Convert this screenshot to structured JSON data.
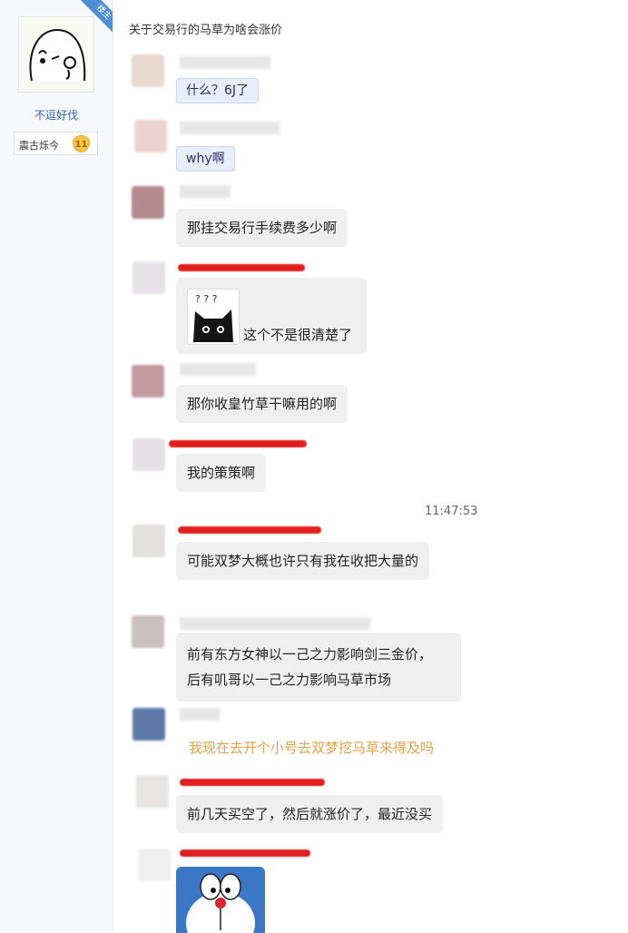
{
  "sidebar": {
    "badge": "楼主",
    "username": "不逗好伐",
    "rank_name": "震古烁今",
    "rank_level": "11"
  },
  "post": {
    "title": "关于交易行的马草为啥会涨价"
  },
  "timestamp": "11:47:53",
  "messages": [
    {
      "text": "什么？6J了"
    },
    {
      "text": "why啊"
    },
    {
      "text": "那挂交易行手续费多少啊"
    },
    {
      "text": "这个不是很清楚了"
    },
    {
      "text": "那你收皇竹草干嘛用的啊"
    },
    {
      "text": "我的策策啊"
    },
    {
      "text": "可能双梦大概也许只有我在收把大量的"
    },
    {
      "line1": "前有东方女神以一己之力影响剑三金价，",
      "line2": "后有叽哥以一己之力影响马草市场"
    },
    {
      "text": "我现在去开个小号去双梦挖马草来得及吗"
    },
    {
      "text": "前几天买空了，然后就涨价了，最近没买"
    }
  ],
  "icons": {
    "avatar": "cartoon-face-avatar",
    "level": "shield-level-icon",
    "sticker_cat": "black-cat-question-sticker",
    "sticker_doraemon": "doraemon-sticker"
  },
  "colors": {
    "link_blue": "#2d64b3",
    "bubble_gray": "#efefef",
    "bubble_blue": "#e8effb",
    "orange_text": "#e4a24a",
    "scribble_red": "#e22020"
  }
}
